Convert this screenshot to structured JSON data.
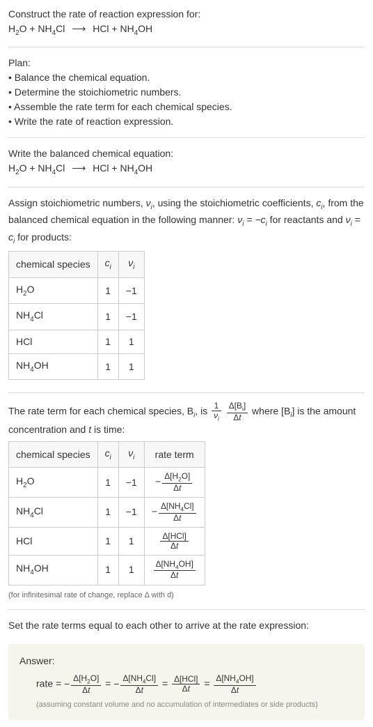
{
  "intro": {
    "line1": "Construct the rate of reaction expression for:",
    "equation": "H₂O + NH₄Cl ⟶ HCl + NH₄OH"
  },
  "plan": {
    "header": "Plan:",
    "items": [
      "• Balance the chemical equation.",
      "• Determine the stoichiometric numbers.",
      "• Assemble the rate term for each chemical species.",
      "• Write the rate of reaction expression."
    ]
  },
  "balanced": {
    "text": "Write the balanced chemical equation:",
    "equation": "H₂O + NH₄Cl ⟶ HCl + NH₄OH"
  },
  "assign": {
    "text_parts": {
      "p1": "Assign stoichiometric numbers, ",
      "nu_i": "ν",
      "sub_i": "i",
      "p2": ", using the stoichiometric coefficients, ",
      "c_i": "c",
      "p3": ", from the balanced chemical equation in the following manner: ",
      "eq1": "νᵢ = −cᵢ",
      "p4": " for reactants and ",
      "eq2": "νᵢ = cᵢ",
      "p5": " for products:"
    },
    "table": {
      "headers": [
        "chemical species",
        "cᵢ",
        "νᵢ"
      ],
      "rows": [
        {
          "species": "H₂O",
          "c": "1",
          "nu": "−1"
        },
        {
          "species": "NH₄Cl",
          "c": "1",
          "nu": "−1"
        },
        {
          "species": "HCl",
          "c": "1",
          "nu": "1"
        },
        {
          "species": "NH₄OH",
          "c": "1",
          "nu": "1"
        }
      ]
    }
  },
  "rate_term": {
    "text_parts": {
      "p1": "The rate term for each chemical species, B",
      "sub_i": "i",
      "p2": ", is ",
      "frac1_num": "1",
      "frac1_den": "νᵢ",
      "frac2_num": "Δ[Bᵢ]",
      "frac2_den": "Δt",
      "p3": " where [B",
      "p4": "] is the amount concentration and ",
      "t": "t",
      "p5": " is time:"
    },
    "table": {
      "headers": [
        "chemical species",
        "cᵢ",
        "νᵢ",
        "rate term"
      ],
      "rows": [
        {
          "species": "H₂O",
          "c": "1",
          "nu": "−1",
          "sign": "−",
          "num": "Δ[H₂O]",
          "den": "Δt"
        },
        {
          "species": "NH₄Cl",
          "c": "1",
          "nu": "−1",
          "sign": "−",
          "num": "Δ[NH₄Cl]",
          "den": "Δt"
        },
        {
          "species": "HCl",
          "c": "1",
          "nu": "1",
          "sign": "",
          "num": "Δ[HCl]",
          "den": "Δt"
        },
        {
          "species": "NH₄OH",
          "c": "1",
          "nu": "1",
          "sign": "",
          "num": "Δ[NH₄OH]",
          "den": "Δt"
        }
      ]
    },
    "note": "(for infinitesimal rate of change, replace Δ with d)"
  },
  "final": {
    "text": "Set the rate terms equal to each other to arrive at the rate expression:"
  },
  "answer": {
    "label": "Answer:",
    "rate_prefix": "rate = ",
    "terms": [
      {
        "sign": "−",
        "num": "Δ[H₂O]",
        "den": "Δt"
      },
      {
        "sign": "−",
        "num": "Δ[NH₄Cl]",
        "den": "Δt"
      },
      {
        "sign": "",
        "num": "Δ[HCl]",
        "den": "Δt"
      },
      {
        "sign": "",
        "num": "Δ[NH₄OH]",
        "den": "Δt"
      }
    ],
    "eq": " = ",
    "note": "(assuming constant volume and no accumulation of intermediates or side products)"
  }
}
